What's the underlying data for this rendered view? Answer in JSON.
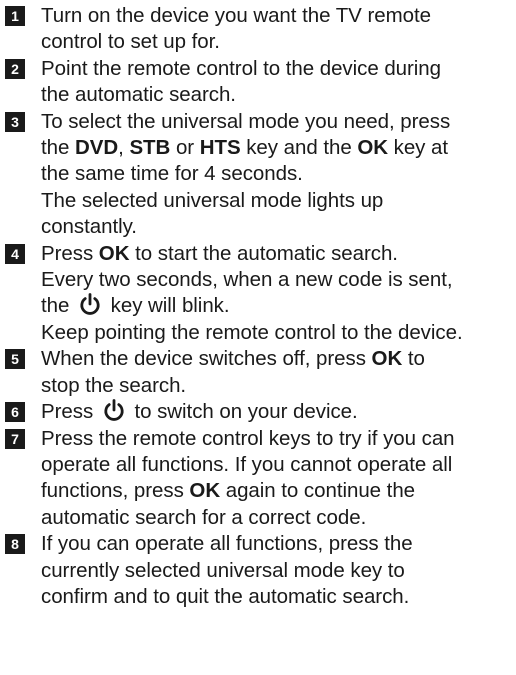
{
  "steps": [
    {
      "number": "1",
      "lines": [
        [
          "Turn on the device you want the TV remote"
        ],
        [
          "control to set up for."
        ]
      ]
    },
    {
      "number": "2",
      "lines": [
        [
          "Point the remote control to the device during"
        ],
        [
          "the automatic search."
        ]
      ]
    },
    {
      "number": "3",
      "lines": [
        [
          "To select the universal mode you need, press"
        ],
        [
          "the ",
          {
            "b": "DVD"
          },
          ", ",
          {
            "b": "STB"
          },
          " or ",
          {
            "b": "HTS"
          },
          " key and the ",
          {
            "b": "OK"
          },
          " key at"
        ],
        [
          "the same time for 4 seconds."
        ],
        [
          "The selected universal mode lights up"
        ],
        [
          "constantly."
        ]
      ]
    },
    {
      "number": "4",
      "lines": [
        [
          "Press ",
          {
            "b": "OK"
          },
          " to start the automatic search."
        ],
        [
          "Every two seconds, when a new code is sent,"
        ],
        [
          "the ",
          {
            "icon": "power-icon"
          },
          " key will blink."
        ],
        [
          "Keep pointing the remote control to the device."
        ]
      ]
    },
    {
      "number": "5",
      "lines": [
        [
          "When the device switches off, press ",
          {
            "b": "OK"
          },
          " to"
        ],
        [
          "stop the search."
        ]
      ]
    },
    {
      "number": "6",
      "lines": [
        [
          "Press ",
          {
            "icon": "power-icon"
          },
          " to switch on your device."
        ]
      ]
    },
    {
      "number": "7",
      "lines": [
        [
          "Press the remote control keys to try if you can"
        ],
        [
          "operate all functions. If you cannot operate all"
        ],
        [
          "functions, press ",
          {
            "b": "OK"
          },
          " again to continue the"
        ],
        [
          "automatic search for a correct code."
        ]
      ]
    },
    {
      "number": "8",
      "lines": [
        [
          "If you can operate all functions, press the"
        ],
        [
          "currently selected universal mode key to"
        ],
        [
          "confirm and to quit the automatic search."
        ]
      ]
    }
  ]
}
